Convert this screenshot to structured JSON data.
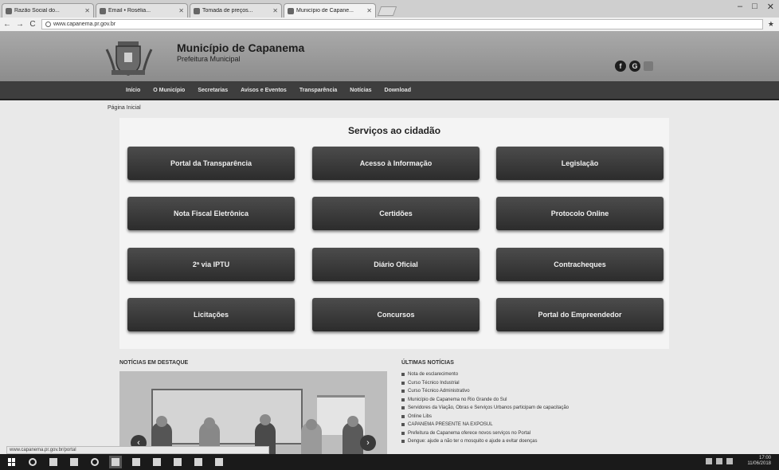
{
  "browser": {
    "tabs": [
      {
        "label": "Razão Social do..."
      },
      {
        "label": "Email • Rosélia..."
      },
      {
        "label": "Tomada de preços..."
      },
      {
        "label": "Município de Capane..."
      }
    ],
    "address": "www.capanema.pr.gov.br",
    "window_controls": [
      "–",
      "□",
      "✕"
    ]
  },
  "header": {
    "title": "Município de Capanema",
    "subtitle": "Prefeitura Municipal",
    "social": [
      "f",
      "G",
      ""
    ]
  },
  "nav": {
    "items": [
      "Início",
      "O Município",
      "Secretarias",
      "Avisos e Eventos",
      "Transparência",
      "Notícias",
      "Download"
    ]
  },
  "breadcrumb": "Página Inicial",
  "services": {
    "title": "Serviços ao cidadão",
    "buttons": [
      "Portal da Transparência",
      "Acesso à Informação",
      "Legislação",
      "Nota Fiscal Eletrônica",
      "Certidões",
      "Protocolo Online",
      "2ª via IPTU",
      "Diário Oficial",
      "Contracheques",
      "Licitações",
      "Concursos",
      "Portal do Empreendedor"
    ]
  },
  "news": {
    "title": "NOTÍCIAS EM DESTAQUE",
    "prev": "‹",
    "next": "›"
  },
  "latest": {
    "title": "ÚLTIMAS NOTÍCIAS",
    "items": [
      "Nota de esclarecimento",
      "Curso Técnico Industrial",
      "Curso Técnico Administrativo",
      "Município de Capanema no Rio Grande do Sul",
      "Servidores da Viação, Obras e Serviços Urbanos participam de capacitação",
      "Online Libs",
      "CAPANEMA PRESENTE NA EXPOSUL",
      "Prefeitura de Capanema oferece novos serviços no Portal",
      "Dengue: ajude a não ter o mosquito e ajude a evitar doenças"
    ]
  },
  "status_url": "www.capanema.pr.gov.br/portal",
  "taskbar": {
    "time": "17:00",
    "date": "11/06/2018"
  }
}
